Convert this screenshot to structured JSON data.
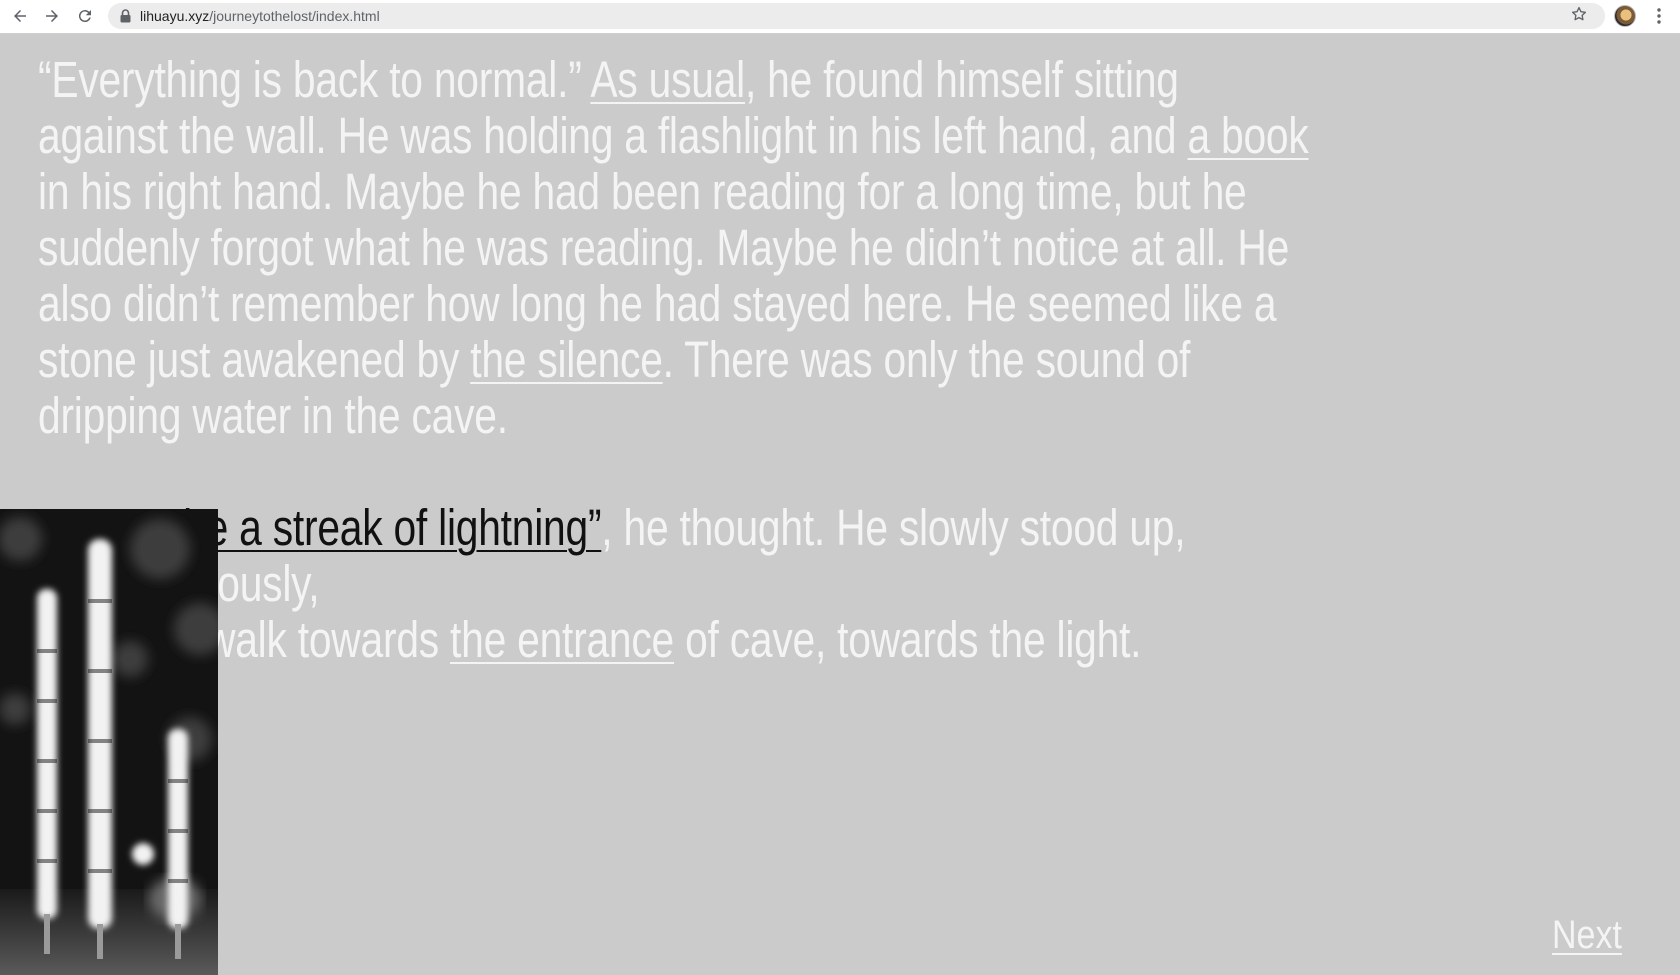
{
  "browser": {
    "url_host": "lihuayu.xyz",
    "url_path": "/journeytothelost/index.html",
    "back_icon": "back-arrow-icon",
    "forward_icon": "forward-arrow-icon",
    "reload_icon": "reload-icon",
    "lock_icon": "lock-icon",
    "bookmark_icon": "star-icon",
    "menu_icon": "kebab-menu-icon"
  },
  "story": {
    "p1": {
      "t1": "“Everything is back to normal.” ",
      "link1": "As usual",
      "t2": ", he found himself sitting against the wall. He was holding a flashlight in his left hand, and ",
      "link2": "a book",
      "t3": " in his right hand. Maybe he had been reading for a long time, but he suddenly forgot what he was reading. Maybe he didn’t notice at all. He also didn’t remember how long he had stayed here. He seemed like a stone just awakened by ",
      "link3": "the silence",
      "t4": ". There was only the sound of dripping water in the cave."
    },
    "p2": {
      "link1": "“It must be a streak of lightning”",
      "t1": ", he thought. He slowly stood up, subconsciously, ",
      "t2": "walk towards ",
      "link2": "the entrance",
      "t3": " of cave, towards the light."
    }
  },
  "next_label": "Next",
  "colors": {
    "background": "#cbcbcb",
    "text": "#f4f4f4",
    "active_link": "#111111"
  }
}
